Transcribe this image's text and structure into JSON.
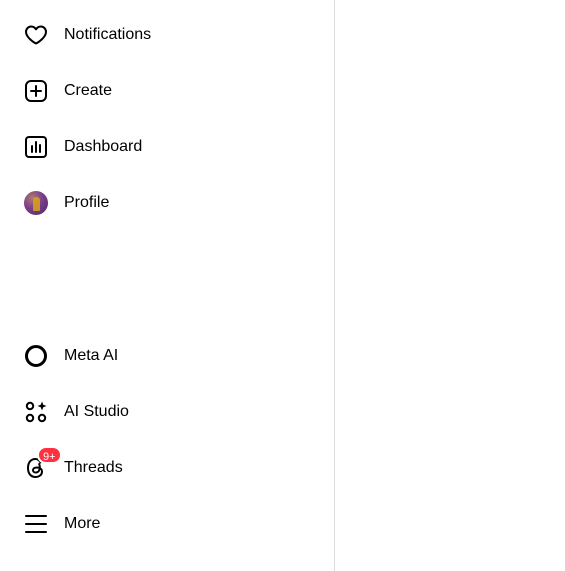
{
  "sidebar": {
    "items": [
      {
        "label": "Notifications",
        "icon": "heart-icon"
      },
      {
        "label": "Create",
        "icon": "plus-square-icon"
      },
      {
        "label": "Dashboard",
        "icon": "bar-chart-icon"
      },
      {
        "label": "Profile",
        "icon": "avatar"
      }
    ],
    "bottom_items": [
      {
        "label": "Meta AI",
        "icon": "meta-ai-ring-icon"
      },
      {
        "label": "AI Studio",
        "icon": "ai-studio-icon"
      },
      {
        "label": "Threads",
        "icon": "threads-icon",
        "badge": "9+"
      },
      {
        "label": "More",
        "icon": "hamburger-menu-icon"
      }
    ]
  },
  "colors": {
    "text": "#000000",
    "badge": "#ff3040",
    "divider": "#dbdbdb"
  }
}
